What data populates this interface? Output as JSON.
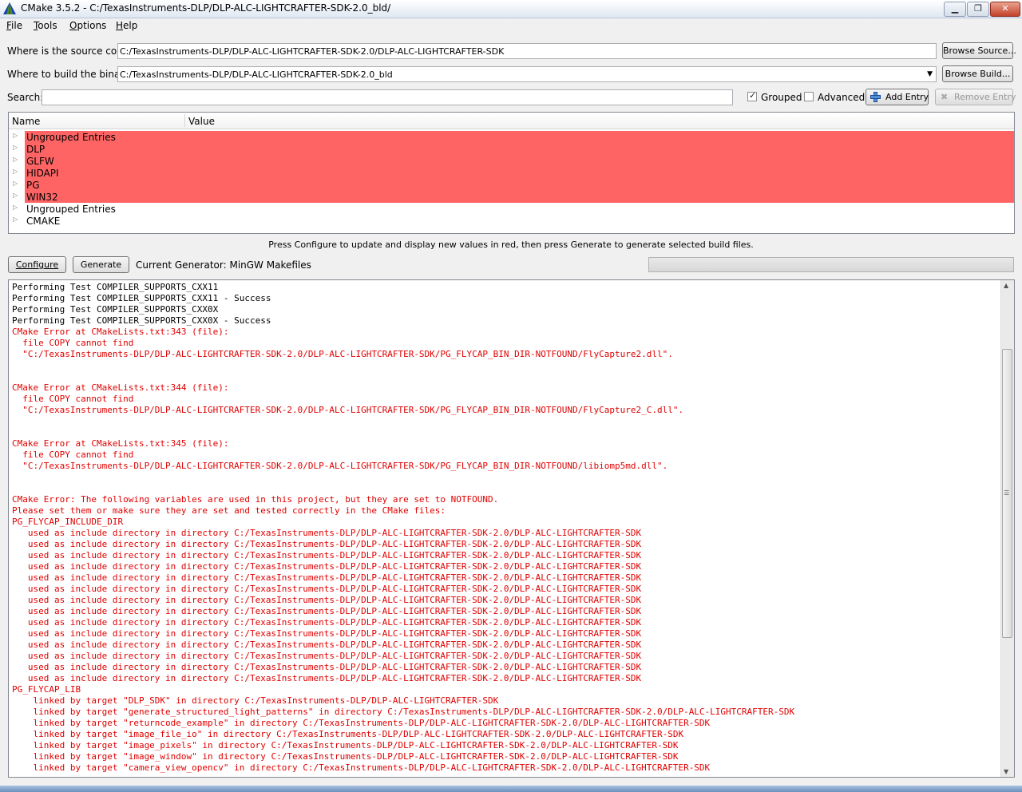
{
  "window": {
    "title": "CMake 3.5.2 - C:/TexasInstruments-DLP/DLP-ALC-LIGHTCRAFTER-SDK-2.0_bld/",
    "min_label": "▁",
    "max_label": "❐",
    "close_label": "✕"
  },
  "menu": [
    {
      "label": "File",
      "mnemonic": "F",
      "rest": "ile"
    },
    {
      "label": "Tools",
      "mnemonic": "T",
      "rest": "ools"
    },
    {
      "label": "Options",
      "mnemonic": "O",
      "rest": "ptions"
    },
    {
      "label": "Help",
      "mnemonic": "H",
      "rest": "elp"
    }
  ],
  "source": {
    "label": "Where is the source code:",
    "value": "C:/TexasInstruments-DLP/DLP-ALC-LIGHTCRAFTER-SDK-2.0/DLP-ALC-LIGHTCRAFTER-SDK",
    "browse_label": "Browse Source..."
  },
  "build": {
    "label": "Where to build the binaries:",
    "value": "C:/TexasInstruments-DLP/DLP-ALC-LIGHTCRAFTER-SDK-2.0_bld",
    "browse_label": "Browse Build..."
  },
  "search": {
    "label": "Search:",
    "value": "",
    "grouped_label": "Grouped",
    "grouped_checked": true,
    "advanced_label": "Advanced",
    "advanced_checked": false,
    "add_entry_label": "Add Entry",
    "remove_entry_label": "Remove Entry"
  },
  "tree": {
    "headers": [
      "Name",
      "Value"
    ],
    "rows": [
      {
        "name": "Ungrouped Entries",
        "highlight": true
      },
      {
        "name": "DLP",
        "highlight": true
      },
      {
        "name": "GLFW",
        "highlight": true
      },
      {
        "name": "HIDAPI",
        "highlight": true
      },
      {
        "name": "PG",
        "highlight": true
      },
      {
        "name": "WIN32",
        "highlight": true
      },
      {
        "name": "Ungrouped Entries",
        "highlight": false
      },
      {
        "name": "CMAKE",
        "highlight": false
      }
    ],
    "highlight_color": "#ff6464"
  },
  "hint": "Press Configure to update and display new values in red, then press Generate to generate selected build files.",
  "actions": {
    "configure_label": "Configure",
    "generate_label": "Generate",
    "generator_text": "Current Generator: MinGW Makefiles"
  },
  "output": {
    "error_color": "#e00000",
    "lines": [
      {
        "t": "Performing Test COMPILER_SUPPORTS_CXX11",
        "c": "k"
      },
      {
        "t": "Performing Test COMPILER_SUPPORTS_CXX11 - Success",
        "c": "k"
      },
      {
        "t": "Performing Test COMPILER_SUPPORTS_CXX0X",
        "c": "k"
      },
      {
        "t": "Performing Test COMPILER_SUPPORTS_CXX0X - Success",
        "c": "k"
      },
      {
        "t": "CMake Error at CMakeLists.txt:343 (file):",
        "c": "e"
      },
      {
        "t": "  file COPY cannot find",
        "c": "e"
      },
      {
        "t": "  \"C:/TexasInstruments-DLP/DLP-ALC-LIGHTCRAFTER-SDK-2.0/DLP-ALC-LIGHTCRAFTER-SDK/PG_FLYCAP_BIN_DIR-NOTFOUND/FlyCapture2.dll\".",
        "c": "e"
      },
      {
        "t": "",
        "c": "e"
      },
      {
        "t": "",
        "c": "e"
      },
      {
        "t": "CMake Error at CMakeLists.txt:344 (file):",
        "c": "e"
      },
      {
        "t": "  file COPY cannot find",
        "c": "e"
      },
      {
        "t": "  \"C:/TexasInstruments-DLP/DLP-ALC-LIGHTCRAFTER-SDK-2.0/DLP-ALC-LIGHTCRAFTER-SDK/PG_FLYCAP_BIN_DIR-NOTFOUND/FlyCapture2_C.dll\".",
        "c": "e"
      },
      {
        "t": "",
        "c": "e"
      },
      {
        "t": "",
        "c": "e"
      },
      {
        "t": "CMake Error at CMakeLists.txt:345 (file):",
        "c": "e"
      },
      {
        "t": "  file COPY cannot find",
        "c": "e"
      },
      {
        "t": "  \"C:/TexasInstruments-DLP/DLP-ALC-LIGHTCRAFTER-SDK-2.0/DLP-ALC-LIGHTCRAFTER-SDK/PG_FLYCAP_BIN_DIR-NOTFOUND/libiomp5md.dll\".",
        "c": "e"
      },
      {
        "t": "",
        "c": "e"
      },
      {
        "t": "",
        "c": "e"
      },
      {
        "t": "CMake Error: The following variables are used in this project, but they are set to NOTFOUND.",
        "c": "e"
      },
      {
        "t": "Please set them or make sure they are set and tested correctly in the CMake files:",
        "c": "e"
      },
      {
        "t": "PG_FLYCAP_INCLUDE_DIR",
        "c": "e"
      },
      {
        "t": "   used as include directory in directory C:/TexasInstruments-DLP/DLP-ALC-LIGHTCRAFTER-SDK-2.0/DLP-ALC-LIGHTCRAFTER-SDK",
        "c": "e"
      },
      {
        "t": "   used as include directory in directory C:/TexasInstruments-DLP/DLP-ALC-LIGHTCRAFTER-SDK-2.0/DLP-ALC-LIGHTCRAFTER-SDK",
        "c": "e"
      },
      {
        "t": "   used as include directory in directory C:/TexasInstruments-DLP/DLP-ALC-LIGHTCRAFTER-SDK-2.0/DLP-ALC-LIGHTCRAFTER-SDK",
        "c": "e"
      },
      {
        "t": "   used as include directory in directory C:/TexasInstruments-DLP/DLP-ALC-LIGHTCRAFTER-SDK-2.0/DLP-ALC-LIGHTCRAFTER-SDK",
        "c": "e"
      },
      {
        "t": "   used as include directory in directory C:/TexasInstruments-DLP/DLP-ALC-LIGHTCRAFTER-SDK-2.0/DLP-ALC-LIGHTCRAFTER-SDK",
        "c": "e"
      },
      {
        "t": "   used as include directory in directory C:/TexasInstruments-DLP/DLP-ALC-LIGHTCRAFTER-SDK-2.0/DLP-ALC-LIGHTCRAFTER-SDK",
        "c": "e"
      },
      {
        "t": "   used as include directory in directory C:/TexasInstruments-DLP/DLP-ALC-LIGHTCRAFTER-SDK-2.0/DLP-ALC-LIGHTCRAFTER-SDK",
        "c": "e"
      },
      {
        "t": "   used as include directory in directory C:/TexasInstruments-DLP/DLP-ALC-LIGHTCRAFTER-SDK-2.0/DLP-ALC-LIGHTCRAFTER-SDK",
        "c": "e"
      },
      {
        "t": "   used as include directory in directory C:/TexasInstruments-DLP/DLP-ALC-LIGHTCRAFTER-SDK-2.0/DLP-ALC-LIGHTCRAFTER-SDK",
        "c": "e"
      },
      {
        "t": "   used as include directory in directory C:/TexasInstruments-DLP/DLP-ALC-LIGHTCRAFTER-SDK-2.0/DLP-ALC-LIGHTCRAFTER-SDK",
        "c": "e"
      },
      {
        "t": "   used as include directory in directory C:/TexasInstruments-DLP/DLP-ALC-LIGHTCRAFTER-SDK-2.0/DLP-ALC-LIGHTCRAFTER-SDK",
        "c": "e"
      },
      {
        "t": "   used as include directory in directory C:/TexasInstruments-DLP/DLP-ALC-LIGHTCRAFTER-SDK-2.0/DLP-ALC-LIGHTCRAFTER-SDK",
        "c": "e"
      },
      {
        "t": "   used as include directory in directory C:/TexasInstruments-DLP/DLP-ALC-LIGHTCRAFTER-SDK-2.0/DLP-ALC-LIGHTCRAFTER-SDK",
        "c": "e"
      },
      {
        "t": "   used as include directory in directory C:/TexasInstruments-DLP/DLP-ALC-LIGHTCRAFTER-SDK-2.0/DLP-ALC-LIGHTCRAFTER-SDK",
        "c": "e"
      },
      {
        "t": "PG_FLYCAP_LIB",
        "c": "e"
      },
      {
        "t": "    linked by target \"DLP_SDK\" in directory C:/TexasInstruments-DLP/DLP-ALC-LIGHTCRAFTER-SDK",
        "c": "e"
      },
      {
        "t": "    linked by target \"generate_structured_light_patterns\" in directory C:/TexasInstruments-DLP/DLP-ALC-LIGHTCRAFTER-SDK-2.0/DLP-ALC-LIGHTCRAFTER-SDK",
        "c": "e"
      },
      {
        "t": "    linked by target \"returncode_example\" in directory C:/TexasInstruments-DLP/DLP-ALC-LIGHTCRAFTER-SDK-2.0/DLP-ALC-LIGHTCRAFTER-SDK",
        "c": "e"
      },
      {
        "t": "    linked by target \"image_file_io\" in directory C:/TexasInstruments-DLP/DLP-ALC-LIGHTCRAFTER-SDK-2.0/DLP-ALC-LIGHTCRAFTER-SDK",
        "c": "e"
      },
      {
        "t": "    linked by target \"image_pixels\" in directory C:/TexasInstruments-DLP/DLP-ALC-LIGHTCRAFTER-SDK-2.0/DLP-ALC-LIGHTCRAFTER-SDK",
        "c": "e"
      },
      {
        "t": "    linked by target \"image_window\" in directory C:/TexasInstruments-DLP/DLP-ALC-LIGHTCRAFTER-SDK-2.0/DLP-ALC-LIGHTCRAFTER-SDK",
        "c": "e"
      },
      {
        "t": "    linked by target \"camera_view_opencv\" in directory C:/TexasInstruments-DLP/DLP-ALC-LIGHTCRAFTER-SDK-2.0/DLP-ALC-LIGHTCRAFTER-SDK",
        "c": "e"
      }
    ]
  }
}
